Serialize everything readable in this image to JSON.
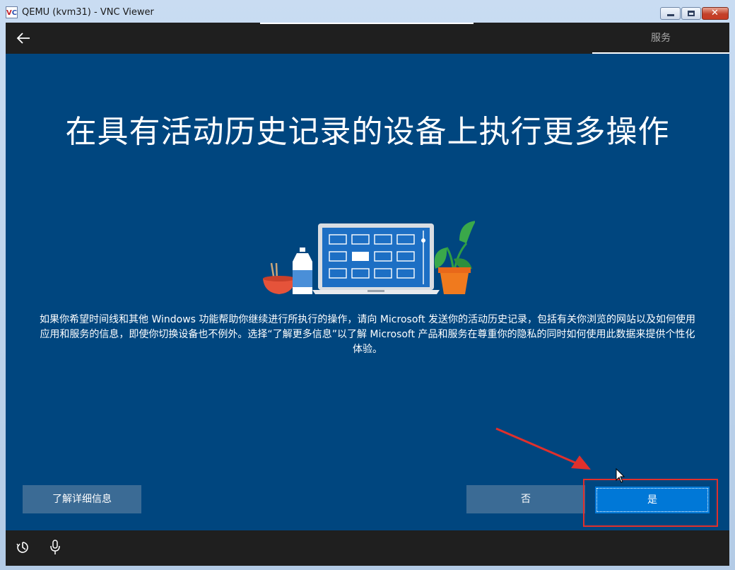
{
  "window": {
    "title": "QEMU (kvm31) - VNC Viewer",
    "app_icon_letters": [
      "V",
      "C"
    ]
  },
  "oobe": {
    "top_tab": "服务",
    "headline": "在具有活动历史记录的设备上执行更多操作",
    "body": "如果你希望时间线和其他 Windows 功能帮助你继续进行所执行的操作，请向 Microsoft 发送你的活动历史记录，包括有关你浏览的网站以及如何使用应用和服务的信息，即使你切换设备也不例外。选择“了解更多信息”以了解 Microsoft 产品和服务在尊重你的隐私的同时如何使用此数据来提供个性化体验。",
    "buttons": {
      "learn_more": "了解详细信息",
      "no": "否",
      "yes": "是"
    },
    "icons": [
      "back-arrow-icon",
      "ease-of-access-icon",
      "microphone-icon"
    ]
  },
  "colors": {
    "background": "#00467f",
    "bar": "#1f1f1f",
    "primary_button": "#0078d7",
    "secondary_button": "#3b6b95",
    "annotation": "#e0302c"
  }
}
